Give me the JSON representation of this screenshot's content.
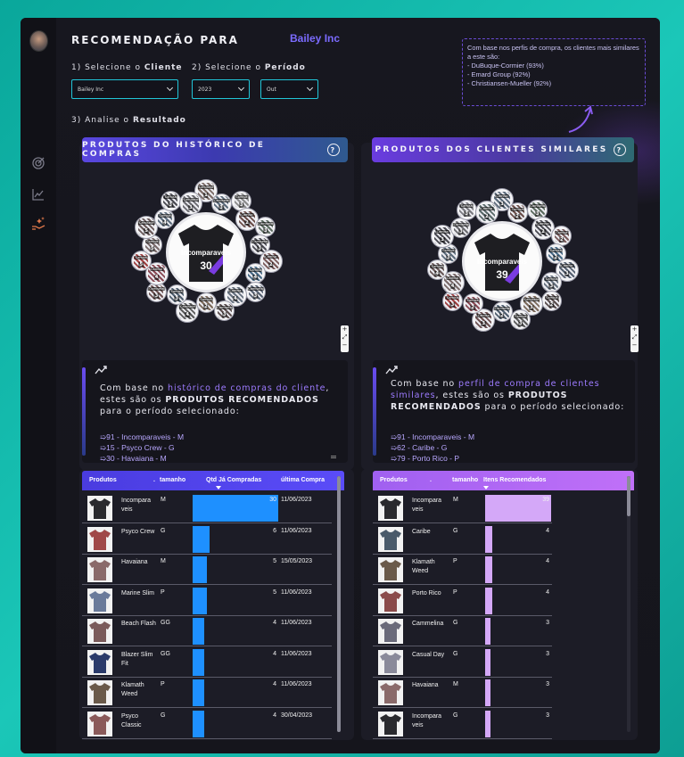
{
  "header": {
    "title": "RECOMENDAÇÃO PARA",
    "client_name": "Bailey Inc",
    "step1_prefix": "1) Selecione o ",
    "step1_bold": "Cliente",
    "step2_prefix": "2) Selecione o ",
    "step2_bold": "Período",
    "step3_prefix": "3) Analise o ",
    "step3_bold": "Resultado"
  },
  "filters": {
    "client_value": "Bailey Inc",
    "year_value": "2023",
    "month_value": "Out"
  },
  "similar_note": {
    "intro": "Com base nos perfis de compra, os clientes mais similares a este são:",
    "items": [
      "- DuBuque-Cormier (93%)",
      "- Emard Group (92%)",
      "- Christiansen-Mueller (92%)"
    ]
  },
  "left_panel": {
    "header": "PRODUTOS DO HISTÓRICO DE COMPRAS",
    "center_product": {
      "name": "Incomparaveis",
      "count": "30"
    },
    "bubbles": [
      {
        "label": "Camiseta",
        "count": "1",
        "color": "#7b6b66"
      },
      {
        "label": "Camiseta",
        "count": "3",
        "color": "#5a6a7a"
      },
      {
        "label": "Camisa",
        "count": "3",
        "color": "#8a8a8a"
      },
      {
        "label": "Camisa",
        "count": "2",
        "color": "#6c4f4a"
      },
      {
        "label": "Camiseta",
        "count": "3",
        "color": "#5b6b5f"
      },
      {
        "label": "Camiseta",
        "count": "3",
        "color": "#4d4d55"
      },
      {
        "label": "Camisa",
        "count": "2",
        "color": "#7a5a5a"
      },
      {
        "label": "Camisa",
        "count": "4",
        "color": "#486a86"
      },
      {
        "label": "Camiseta",
        "count": "3",
        "color": "#556070"
      },
      {
        "label": "Camisa",
        "count": "4",
        "color": "#65707e"
      },
      {
        "label": "Camiseta",
        "count": "3",
        "color": "#5a4d4d"
      },
      {
        "label": "Camisa",
        "count": "2",
        "color": "#7c6a5b"
      },
      {
        "label": "Camiseta",
        "count": "4",
        "color": "#5a5a5a"
      },
      {
        "label": "Camisa",
        "count": "3",
        "color": "#4f5f6f"
      },
      {
        "label": "Camiseta",
        "count": "3",
        "color": "#6c5050"
      },
      {
        "label": "Camisa",
        "count": "4",
        "color": "#8a4a55"
      },
      {
        "label": "Camisa",
        "count": "5",
        "color": "#a04040"
      },
      {
        "label": "Camisa",
        "count": "5",
        "color": "#7a6a6a"
      },
      {
        "label": "Camiseta",
        "count": "5",
        "color": "#6a5a5a"
      },
      {
        "label": "Camisa",
        "count": "4",
        "color": "#5c6c7c"
      },
      {
        "label": "Camisa",
        "count": "3",
        "color": "#4a4a52"
      },
      {
        "label": "Camiseta",
        "count": "3",
        "color": "#6b6b70"
      }
    ],
    "rec_intro_1": "Com base no ",
    "rec_highlight": "histórico de compras do cliente",
    "rec_intro_2": ", estes são os ",
    "rec_bold": "PRODUTOS RECOMENDADOS",
    "rec_intro_3": " para o período selecionado:",
    "rec_items": [
      "➯91 - Incomparaveis - M",
      "➯15 - Psyco Crew - G",
      "➯30 - Havaiana - M"
    ],
    "table": {
      "headers": {
        "produtos": "Produtos",
        "dot": ".",
        "tamanho": "tamanho",
        "qtd": "Qtd Já Compradas",
        "ultima": "última Compra"
      },
      "max": 30,
      "rows": [
        {
          "name": "Incompara veis",
          "size": "M",
          "qty": 30,
          "qty_label": "30",
          "date": "11/06/2023",
          "thumb": "#2a2a2e"
        },
        {
          "name": "Psyco Crew",
          "size": "G",
          "qty": 6,
          "qty_label": "6",
          "date": "11/06/2023",
          "thumb": "#a04848"
        },
        {
          "name": "Havaiana",
          "size": "M",
          "qty": 5,
          "qty_label": "5",
          "date": "15/05/2023",
          "thumb": "#8a6a6a"
        },
        {
          "name": "Marine Slim",
          "size": "P",
          "qty": 5,
          "qty_label": "5",
          "date": "11/06/2023",
          "thumb": "#6a7a9a"
        },
        {
          "name": "Beach Flash",
          "size": "GG",
          "qty": 4,
          "qty_label": "4",
          "date": "11/06/2023",
          "thumb": "#7a5a5a"
        },
        {
          "name": "Blazer Slim Fit",
          "size": "GG",
          "qty": 4,
          "qty_label": "4",
          "date": "11/06/2023",
          "thumb": "#2a3a6a"
        },
        {
          "name": "Klamath Weed",
          "size": "P",
          "qty": 4,
          "qty_label": "4",
          "date": "11/06/2023",
          "thumb": "#6a5a4a"
        },
        {
          "name": "Psyco Classic",
          "size": "G",
          "qty": 4,
          "qty_label": "4",
          "date": "30/04/2023",
          "thumb": "#8a5a5a"
        }
      ]
    }
  },
  "right_panel": {
    "header": "PRODUTOS DOS CLIENTES SIMILARES",
    "center_product": {
      "name": "Incomparaveis",
      "count": "39"
    },
    "bubbles": [
      {
        "label": "Camisa",
        "count": "3",
        "color": "#5a6a7a"
      },
      {
        "label": "Camisa",
        "count": "2",
        "color": "#6c4f4a"
      },
      {
        "label": "Camiseta",
        "count": "3",
        "color": "#5b6b5f"
      },
      {
        "label": "Camisa",
        "count": "2",
        "color": "#4d4d55"
      },
      {
        "label": "Camisa",
        "count": "2",
        "color": "#7a5a5a"
      },
      {
        "label": "Camisa",
        "count": "2",
        "color": "#486a86"
      },
      {
        "label": "Camisa",
        "count": "3",
        "color": "#556070"
      },
      {
        "label": "Camisa",
        "count": "3",
        "color": "#65707e"
      },
      {
        "label": "Camisa",
        "count": "2",
        "color": "#5a4d4d"
      },
      {
        "label": "Camiseta",
        "count": "3",
        "color": "#7c6a5b"
      },
      {
        "label": "Camisa",
        "count": "3",
        "color": "#5a5a5a"
      },
      {
        "label": "Camiseta",
        "count": "2",
        "color": "#4f5f6f"
      },
      {
        "label": "Camisa",
        "count": "3",
        "color": "#6c5050"
      },
      {
        "label": "Camisa",
        "count": "2",
        "color": "#8a4a55"
      },
      {
        "label": "Camisa",
        "count": "3",
        "color": "#a04040"
      },
      {
        "label": "Camisa",
        "count": "4",
        "color": "#7a6a6a"
      },
      {
        "label": "Camisa",
        "count": "4",
        "color": "#6a5a5a"
      },
      {
        "label": "Camisa",
        "count": "3",
        "color": "#5c6c7c"
      },
      {
        "label": "Camisa",
        "count": "3",
        "color": "#4a4a52"
      },
      {
        "label": "Camiseta",
        "count": "3",
        "color": "#6b6b70"
      },
      {
        "label": "Camisa",
        "count": "3",
        "color": "#7a7a80"
      },
      {
        "label": "Camisa",
        "count": "2",
        "color": "#5a6a6a"
      }
    ],
    "rec_intro_1": "Com base no ",
    "rec_highlight": "perfil de compra de clientes similares",
    "rec_intro_2": ", estes são os ",
    "rec_bold": "PRODUTOS RECOMENDADOS",
    "rec_intro_3": " para o período selecionado:",
    "rec_items": [
      "➯91 - Incomparaveis - M",
      "➯62 - Caribe - G",
      "➯79 - Porto Rico - P"
    ],
    "table": {
      "headers": {
        "produtos": "Produtos",
        "dot": ".",
        "tamanho": "tamanho",
        "itens": "Itens Recomendados"
      },
      "max": 39,
      "rows": [
        {
          "name": "Incompara veis",
          "size": "M",
          "qty": 39,
          "qty_label": "39",
          "thumb": "#2a2a2e"
        },
        {
          "name": "Caribe",
          "size": "G",
          "qty": 4,
          "qty_label": "4",
          "thumb": "#4a5a6a"
        },
        {
          "name": "Klamath Weed",
          "size": "P",
          "qty": 4,
          "qty_label": "4",
          "thumb": "#6a5a4a"
        },
        {
          "name": "Porto Rico",
          "size": "P",
          "qty": 4,
          "qty_label": "4",
          "thumb": "#8a4a4a"
        },
        {
          "name": "Cammelina",
          "size": "G",
          "qty": 3,
          "qty_label": "3",
          "thumb": "#6a6a7a"
        },
        {
          "name": "Casual Day",
          "size": "G",
          "qty": 3,
          "qty_label": "3",
          "thumb": "#8a8a9a"
        },
        {
          "name": "Havaiana",
          "size": "M",
          "qty": 3,
          "qty_label": "3",
          "thumb": "#8a6a6a"
        },
        {
          "name": "Incompara veis",
          "size": "G",
          "qty": 3,
          "qty_label": "3",
          "thumb": "#2a2a2e"
        }
      ]
    }
  }
}
